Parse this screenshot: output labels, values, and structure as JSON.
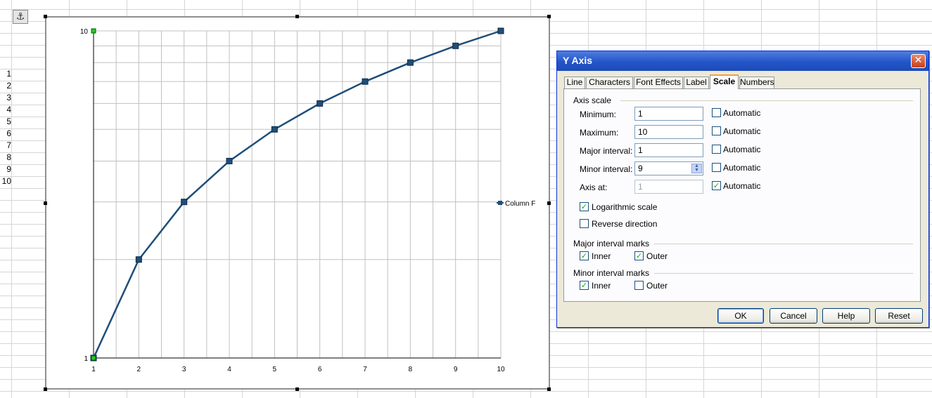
{
  "sheet": {
    "row_numbers": [
      "1",
      "2",
      "3",
      "4",
      "5",
      "6",
      "7",
      "8",
      "9",
      "10"
    ]
  },
  "chart": {
    "legend_label": "Column F"
  },
  "chart_data": {
    "type": "line",
    "x": [
      1,
      2,
      3,
      4,
      5,
      6,
      7,
      8,
      9,
      10
    ],
    "series": [
      {
        "name": "Column F",
        "values": [
          1,
          2,
          3,
          4,
          5,
          6,
          7,
          8,
          9,
          10
        ]
      }
    ],
    "x_tick_labels": [
      "1",
      "2",
      "3",
      "4",
      "5",
      "6",
      "7",
      "8",
      "9",
      "10"
    ],
    "y_tick_labels": [
      "1",
      "10"
    ],
    "xlim": [
      1,
      10
    ],
    "ylim": [
      1,
      10
    ],
    "y_scale": "log",
    "grid": true,
    "legend_position": "right",
    "line_color": "#1f4e79",
    "marker_color": "#1f4e79"
  },
  "dialog": {
    "title": "Y Axis",
    "tabs": [
      "Line",
      "Characters",
      "Font Effects",
      "Label",
      "Scale",
      "Numbers"
    ],
    "active_tab": "Scale",
    "axis_scale_title": "Axis scale",
    "fields": {
      "minimum": {
        "label": "Minimum:",
        "value": "1",
        "auto_label": "Automatic",
        "auto_checked": false
      },
      "maximum": {
        "label": "Maximum:",
        "value": "10",
        "auto_label": "Automatic",
        "auto_checked": false
      },
      "major_interval": {
        "label": "Major interval:",
        "value": "1",
        "auto_label": "Automatic",
        "auto_checked": false
      },
      "minor_interval": {
        "label": "Minor interval:",
        "value": "9",
        "auto_label": "Automatic",
        "auto_checked": false
      },
      "axis_at": {
        "label": "Axis at:",
        "value": "1",
        "auto_label": "Automatic",
        "auto_checked": true
      }
    },
    "logarithmic": {
      "label": "Logarithmic scale",
      "checked": true
    },
    "reverse": {
      "label": "Reverse direction",
      "checked": false
    },
    "major_marks": {
      "title": "Major interval marks",
      "inner": "Inner",
      "inner_checked": true,
      "outer": "Outer",
      "outer_checked": true
    },
    "minor_marks": {
      "title": "Minor interval marks",
      "inner": "Inner",
      "inner_checked": true,
      "outer": "Outer",
      "outer_checked": false
    },
    "buttons": {
      "ok": "OK",
      "cancel": "Cancel",
      "help": "Help",
      "reset": "Reset"
    },
    "close_glyph": "✕"
  }
}
